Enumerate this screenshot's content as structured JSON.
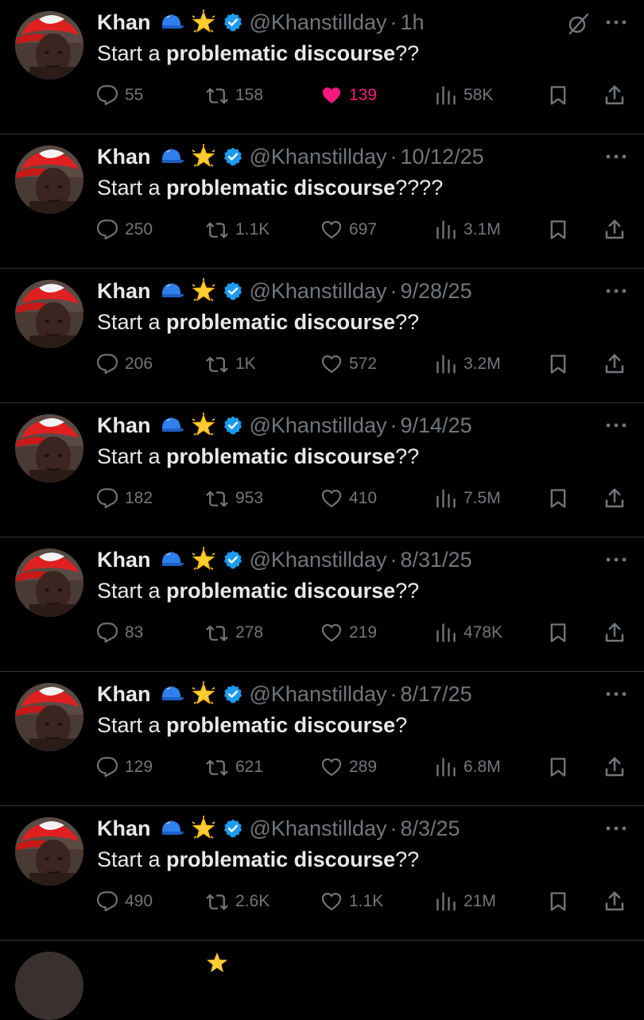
{
  "tweets": [
    {
      "name": "Khan",
      "handle": "@Khanstillday",
      "dot": "·",
      "time": "1h",
      "text_start": "Start a ",
      "text_bold": "problematic discourse",
      "text_end": "??",
      "replies": "55",
      "reposts": "158",
      "likes": "139",
      "liked": true,
      "views": "58K",
      "show_grok": true
    },
    {
      "name": "Khan",
      "handle": "@Khanstillday",
      "dot": "·",
      "time": "10/12/25",
      "text_start": "Start a ",
      "text_bold": "problematic discourse",
      "text_end": "????",
      "replies": "250",
      "reposts": "1.1K",
      "likes": "697",
      "liked": false,
      "views": "3.1M",
      "show_grok": false
    },
    {
      "name": "Khan",
      "handle": "@Khanstillday",
      "dot": "·",
      "time": "9/28/25",
      "text_start": "Start a ",
      "text_bold": "problematic discourse",
      "text_end": "??",
      "replies": "206",
      "reposts": "1K",
      "likes": "572",
      "liked": false,
      "views": "3.2M",
      "show_grok": false
    },
    {
      "name": "Khan",
      "handle": "@Khanstillday",
      "dot": "·",
      "time": "9/14/25",
      "text_start": "Start a ",
      "text_bold": "problematic discourse",
      "text_end": "??",
      "replies": "182",
      "reposts": "953",
      "likes": "410",
      "liked": false,
      "views": "7.5M",
      "show_grok": false
    },
    {
      "name": "Khan",
      "handle": "@Khanstillday",
      "dot": "·",
      "time": "8/31/25",
      "text_start": "Start a ",
      "text_bold": "problematic discourse",
      "text_end": "??",
      "replies": "83",
      "reposts": "278",
      "likes": "219",
      "liked": false,
      "views": "478K",
      "show_grok": false
    },
    {
      "name": "Khan",
      "handle": "@Khanstillday",
      "dot": "·",
      "time": "8/17/25",
      "text_start": "Start a ",
      "text_bold": "problematic discourse",
      "text_end": "?",
      "replies": "129",
      "reposts": "621",
      "likes": "289",
      "liked": false,
      "views": "6.8M",
      "show_grok": false
    },
    {
      "name": "Khan",
      "handle": "@Khanstillday",
      "dot": "·",
      "time": "8/3/25",
      "text_start": "Start a ",
      "text_bold": "problematic discourse",
      "text_end": "??",
      "replies": "490",
      "reposts": "2.6K",
      "likes": "1.1K",
      "liked": false,
      "views": "21M",
      "show_grok": false
    }
  ],
  "emojis": {
    "cap": "blue-cap-icon",
    "star": "glowing-star-icon",
    "verified": "verified-badge-icon"
  },
  "colors": {
    "background": "#000000",
    "text": "#e7e9ea",
    "muted": "#71767b",
    "like": "#f91880",
    "verified": "#1d9bf0",
    "divider": "#2f3336"
  }
}
